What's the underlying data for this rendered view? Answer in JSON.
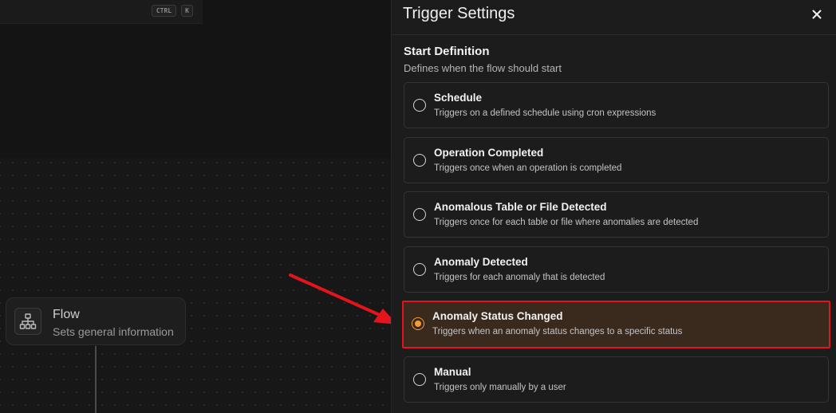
{
  "search": {
    "kbd_ctrl": "CTRL",
    "kbd_k": "K"
  },
  "flow_node": {
    "icon": "sitemap-icon",
    "title": "Flow",
    "subtitle": "Sets general information"
  },
  "panel": {
    "title": "Trigger Settings",
    "close_icon": "close-icon",
    "section_title": "Start Definition",
    "section_subtitle": "Defines when the flow should start",
    "selected_index": 4,
    "options": [
      {
        "title": "Schedule",
        "description": "Triggers on a defined schedule using cron expressions"
      },
      {
        "title": "Operation Completed",
        "description": "Triggers once when an operation is completed"
      },
      {
        "title": "Anomalous Table or File Detected",
        "description": "Triggers once for each table or file where anomalies are detected"
      },
      {
        "title": "Anomaly Detected",
        "description": "Triggers for each anomaly that is detected"
      },
      {
        "title": "Anomaly Status Changed",
        "description": "Triggers when an anomaly status changes to a specific status"
      },
      {
        "title": "Manual",
        "description": "Triggers only manually by a user"
      }
    ]
  },
  "colors": {
    "accent": "#f59a3a",
    "highlight_border": "#e3141b",
    "selected_bg": "#3a2a1e"
  }
}
